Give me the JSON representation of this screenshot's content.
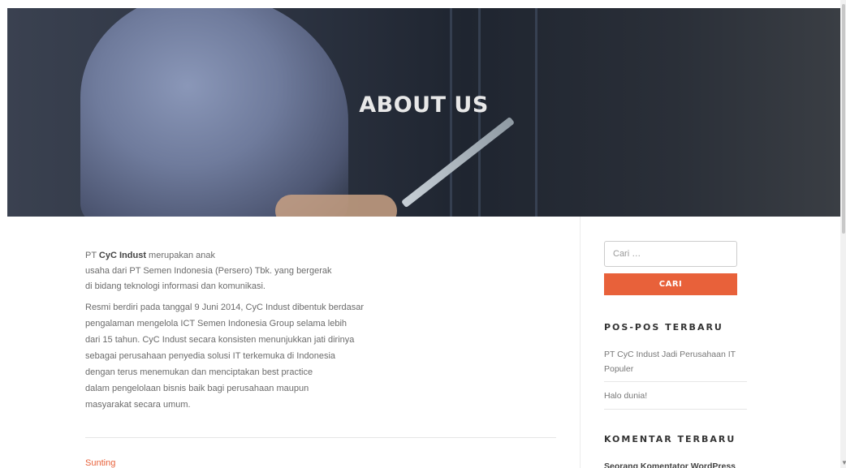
{
  "hero": {
    "title": "ABOUT US"
  },
  "content": {
    "intro_prefix": "PT ",
    "intro_company": "CyC Indust",
    "intro_lines": [
      " merupakan anak",
      "usaha dari PT Semen Indonesia (Persero) Tbk. yang bergerak",
      "di bidang teknologi informasi dan komunikasi."
    ],
    "body_lines": [
      "Resmi berdiri pada tanggal 9 Juni 2014, CyC Indust dibentuk berdasar",
      "pengalaman mengelola ICT Semen Indonesia Group selama lebih",
      "dari 15 tahun. CyC Indust secara konsisten menunjukkan jati dirinya",
      "sebagai perusahaan penyedia solusi IT terkemuka di Indonesia",
      "dengan terus menemukan dan menciptakan best practice",
      "dalam pengelolaan bisnis baik bagi perusahaan maupun",
      "masyarakat secara umum."
    ],
    "edit_link": "Sunting"
  },
  "sidebar": {
    "search": {
      "placeholder": "Cari …",
      "button_label": "CARI"
    },
    "recent_posts": {
      "title": "POS-POS TERBARU",
      "items": [
        "PT CyC Indust Jadi Perusahaan IT Populer",
        "Halo dunia!"
      ]
    },
    "recent_comments": {
      "title": "KOMENTAR TERBARU",
      "first_commenter": "Seorang Komentator WordPress"
    }
  },
  "colors": {
    "accent": "#e8613a",
    "hero_dark": "#2b3240"
  }
}
